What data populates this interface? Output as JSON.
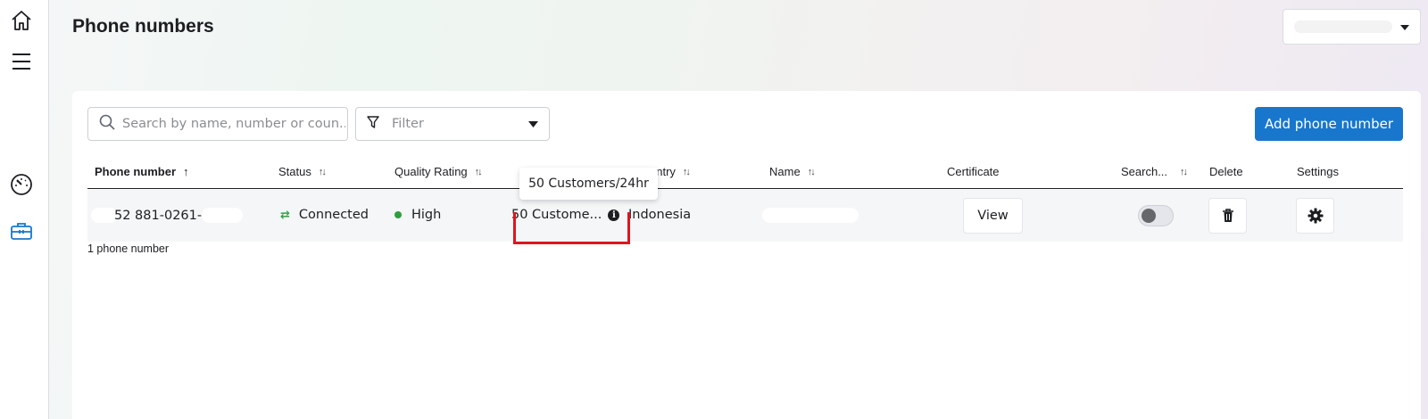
{
  "page": {
    "title": "Phone numbers"
  },
  "nav": {
    "items": [
      {
        "icon": "home-icon"
      },
      {
        "icon": "menu-icon"
      },
      {
        "icon": "gauge-icon"
      },
      {
        "icon": "toolbox-icon",
        "active": true
      }
    ]
  },
  "toolbar": {
    "search_placeholder": "Search by name, number or coun...",
    "filter_label": "Filter",
    "add_label": "Add phone number"
  },
  "table": {
    "headers": {
      "phone": "Phone number",
      "status": "Status",
      "quality": "Quality Rating",
      "country": "untry",
      "name": "Name",
      "certificate": "Certificate",
      "search": "Search...",
      "delete": "Delete",
      "settings": "Settings"
    },
    "rows": [
      {
        "phone": "52 881-0261-",
        "status": "Connected",
        "quality": "High",
        "limit": "50 Custome...",
        "country": "Indonesia",
        "certificate_action": "View"
      }
    ],
    "count_text": "1 phone number"
  },
  "tooltip": {
    "text": "50 Customers/24hr"
  },
  "colors": {
    "primary": "#1877cc",
    "connected": "#31a24c",
    "quality_high": "#2e9e3e",
    "annotation": "#e0141e"
  }
}
